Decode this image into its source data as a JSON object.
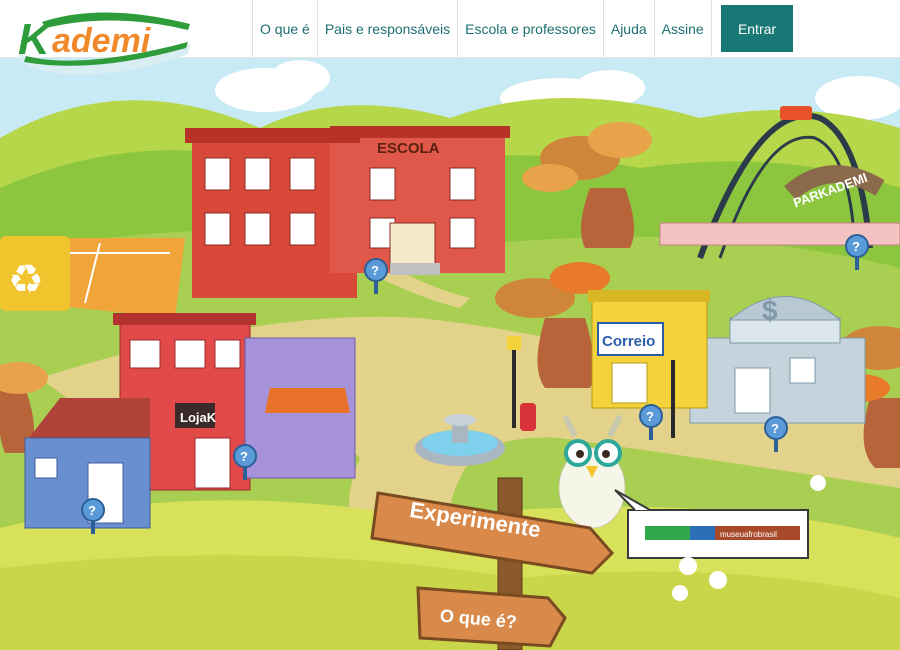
{
  "brand": {
    "logo_text": "Kademi"
  },
  "nav": {
    "items": [
      {
        "label": "O que é"
      },
      {
        "label": "Pais e responsáveis"
      },
      {
        "label": "Escola e professores"
      },
      {
        "label": "Ajuda"
      },
      {
        "label": "Assine"
      }
    ],
    "enter_label": "Entrar"
  },
  "scene": {
    "school_sign": "ESCOLA",
    "store_sign": "LojaK",
    "post_office_sign": "Correio",
    "bank_symbol": "$",
    "park_sign": "PARKADEMI",
    "signpost_primary": "Experimente",
    "signpost_secondary": "O que é?",
    "speech_bubble_logo": "museuafrobrasil",
    "help_marker": "?"
  },
  "colors": {
    "accent": "#177876",
    "link": "#1e6f72",
    "logo_green": "#2e9c3a",
    "logo_orange": "#f0892a",
    "sky": "#c7eaf4",
    "grass": "#8cc63f"
  }
}
